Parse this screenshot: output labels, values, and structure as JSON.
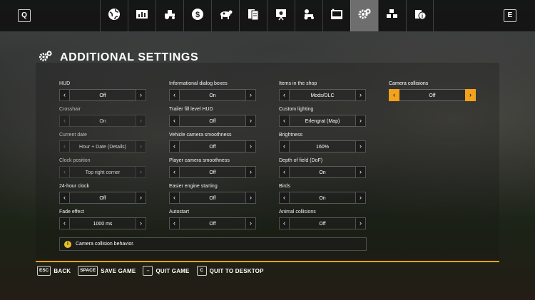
{
  "topbar": {
    "left_key": "Q",
    "right_key": "E",
    "tabs": [
      {
        "icon": "globe-icon"
      },
      {
        "icon": "stats-icon"
      },
      {
        "icon": "tractor-icon"
      },
      {
        "icon": "money-icon"
      },
      {
        "icon": "animals-icon"
      },
      {
        "icon": "contracts-icon"
      },
      {
        "icon": "help-icon"
      },
      {
        "icon": "vehicle-settings-icon"
      },
      {
        "icon": "display-icon"
      },
      {
        "icon": "settings-gear-icon"
      },
      {
        "icon": "production-icon"
      },
      {
        "icon": "info-icon"
      }
    ],
    "active_tab_icon": "settings-gear-icon"
  },
  "panel": {
    "title": "ADDITIONAL SETTINGS",
    "accent_color": "#f3a21c",
    "columns": [
      [
        {
          "label": "HUD",
          "value": "Off",
          "state": "normal"
        },
        {
          "label": "Crosshair",
          "value": "On",
          "state": "disabled"
        },
        {
          "label": "Current date",
          "value": "Hour + Date (Details)",
          "state": "disabled"
        },
        {
          "label": "Clock position",
          "value": "Top right corner",
          "state": "disabled"
        },
        {
          "label": "24-hour clock",
          "value": "Off",
          "state": "normal"
        },
        {
          "label": "Fade effect",
          "value": "1000 ms",
          "state": "normal"
        }
      ],
      [
        {
          "label": "Informational dialog boxes",
          "value": "On",
          "state": "normal"
        },
        {
          "label": "Trailer fill level HUD",
          "value": "Off",
          "state": "normal"
        },
        {
          "label": "Vehicle camera smoothness",
          "value": "Off",
          "state": "normal"
        },
        {
          "label": "Player camera smoothness",
          "value": "Off",
          "state": "normal"
        },
        {
          "label": "Easier engine starting",
          "value": "Off",
          "state": "normal"
        },
        {
          "label": "Autostart",
          "value": "Off",
          "state": "normal"
        }
      ],
      [
        {
          "label": "Items in the shop",
          "value": "Mods/DLC",
          "state": "normal"
        },
        {
          "label": "Custom lighting",
          "value": "Erlengrat (Map)",
          "state": "normal"
        },
        {
          "label": "Brightness",
          "value": "160%",
          "state": "normal"
        },
        {
          "label": "Depth of field (DoF)",
          "value": "On",
          "state": "normal"
        },
        {
          "label": "Birds",
          "value": "On",
          "state": "normal"
        },
        {
          "label": "Animal collisions",
          "value": "Off",
          "state": "normal"
        }
      ],
      [
        {
          "label": "Camera collisions",
          "value": "Off",
          "state": "selected"
        }
      ]
    ],
    "info_text": "Camera collision behavior.",
    "info_icon": "i"
  },
  "footer": [
    {
      "key": "ESC",
      "label": "BACK"
    },
    {
      "key": "SPACE",
      "label": "SAVE GAME"
    },
    {
      "key": "↔",
      "label": "QUIT GAME"
    },
    {
      "key": "C",
      "label": "QUIT TO DESKTOP"
    }
  ],
  "arrows": {
    "left": "‹",
    "right": "›"
  }
}
